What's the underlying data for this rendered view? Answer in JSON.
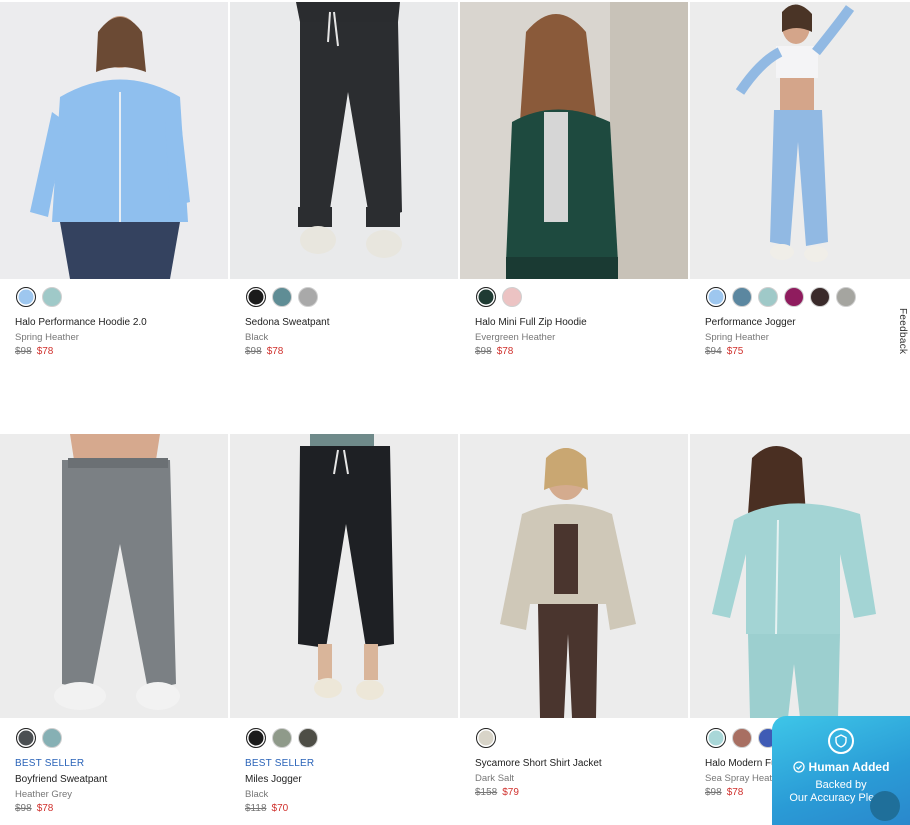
{
  "products": [
    {
      "name": "Halo Performance Hoodie 2.0",
      "color": "Spring Heather",
      "orig_price": "$98",
      "sale_price": "$78",
      "badge": "",
      "swatches": [
        "#9ec7ef",
        "#9fc9c8"
      ]
    },
    {
      "name": "Sedona Sweatpant",
      "color": "Black",
      "orig_price": "$98",
      "sale_price": "$78",
      "badge": "",
      "swatches": [
        "#1b1b1b",
        "#5f8d95",
        "#a9a9a9"
      ]
    },
    {
      "name": "Halo Mini Full Zip Hoodie",
      "color": "Evergreen Heather",
      "orig_price": "$98",
      "sale_price": "$78",
      "badge": "",
      "swatches": [
        "#1f3b33",
        "#ecc3c3"
      ]
    },
    {
      "name": "Performance Jogger",
      "color": "Spring Heather",
      "orig_price": "$94",
      "sale_price": "$75",
      "badge": "",
      "swatches": [
        "#9ec7ef",
        "#5b87a0",
        "#9fc9c8",
        "#8f1c5e",
        "#3a2a2a",
        "#a5a5a0"
      ]
    },
    {
      "name": "Boyfriend Sweatpant",
      "color": "Heather Grey",
      "orig_price": "$98",
      "sale_price": "$78",
      "badge": "BEST SELLER",
      "swatches": [
        "#4b4f52",
        "#86b0b4"
      ]
    },
    {
      "name": "Miles Jogger",
      "color": "Black",
      "orig_price": "$118",
      "sale_price": "$70",
      "badge": "BEST SELLER",
      "swatches": [
        "#1b1b1b",
        "#8f9a8a",
        "#4e4e46"
      ]
    },
    {
      "name": "Sycamore Short Shirt Jacket",
      "color": "Dark Salt",
      "orig_price": "$158",
      "sale_price": "$79",
      "badge": "",
      "swatches": [
        "#d8d4c8"
      ]
    },
    {
      "name": "Halo Modern Full Zip Hoodie",
      "color": "Sea Spray Heather",
      "orig_price": "$98",
      "sale_price": "$78",
      "badge": "",
      "swatches": [
        "#a9d7d8",
        "#a86f62",
        "#3f5bb5"
      ]
    }
  ],
  "feedback": "Feedback",
  "widget": {
    "title": "Human Added",
    "line1": "Backed by",
    "line2": "Our Accuracy Pledge"
  },
  "colors": {
    "sale": "#d0312d",
    "badge": "#2a63b8",
    "widget_bg": "#2a9bd6"
  }
}
